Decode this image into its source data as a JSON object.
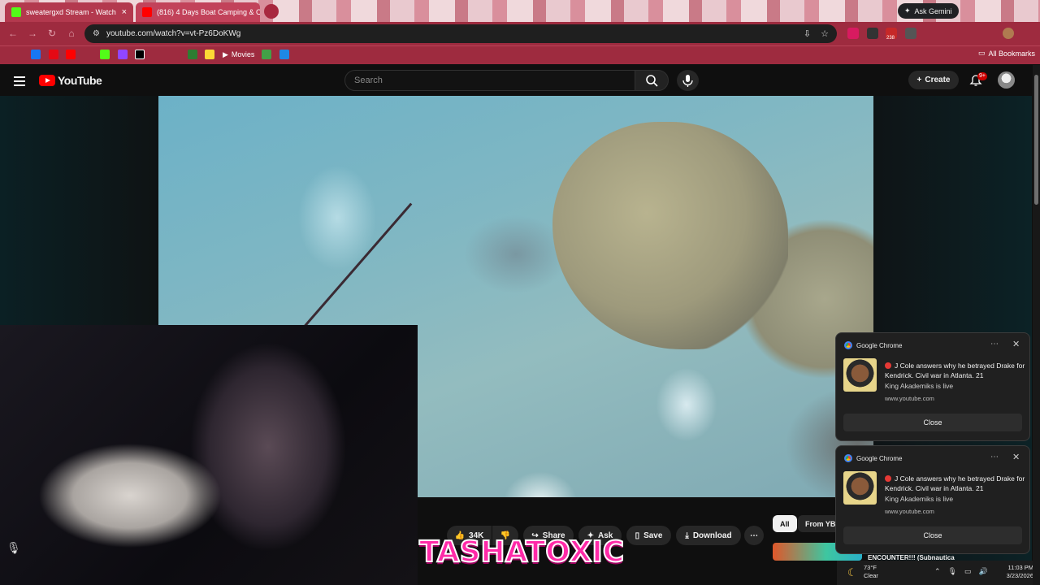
{
  "browser": {
    "tabs": [
      {
        "title": "sweatergxd Stream - Watch",
        "close": "×",
        "favicon_color": "#53fc18"
      },
      {
        "title": "(816) 4 Days Boat Camping & C",
        "close": "×",
        "favicon_color": "#ff0000"
      }
    ],
    "gemini_label": "Ask Gemini",
    "url": "youtube.com/watch?v=vt-Pz6DoKWg",
    "extension_badge": "238",
    "bookmarks": {
      "movies": "Movies",
      "all": "All Bookmarks"
    },
    "theme_color": "#9e2b3f"
  },
  "youtube": {
    "logo": "YouTube",
    "search_placeholder": "Search",
    "create_label": "Create",
    "notif_count": "9+",
    "actions": {
      "likes": "34K",
      "share": "Share",
      "ask": "Ask",
      "save": "Save",
      "download": "Download"
    },
    "chips": [
      "All",
      "From YB"
    ],
    "rec_title": "ENCOUNTER!!! (Subnautica"
  },
  "overlay_text": "TASHATOXIC",
  "toasts": [
    {
      "app": "Google Chrome",
      "message": "J Cole answers why he betrayed Drake for Kendrick. Civil war in Atlanta. 21",
      "sub": "King Akademiks is live",
      "url": "www.youtube.com",
      "button": "Close"
    },
    {
      "app": "Google Chrome",
      "message": "J Cole answers why he betrayed Drake for Kendrick. Civil war in Atlanta. 21",
      "sub": "King Akademiks is live",
      "url": "www.youtube.com",
      "button": "Close"
    }
  ],
  "taskbar": {
    "temp": "73°F",
    "condition": "Clear",
    "time": "11:03 PM",
    "date": "3/23/2026"
  }
}
